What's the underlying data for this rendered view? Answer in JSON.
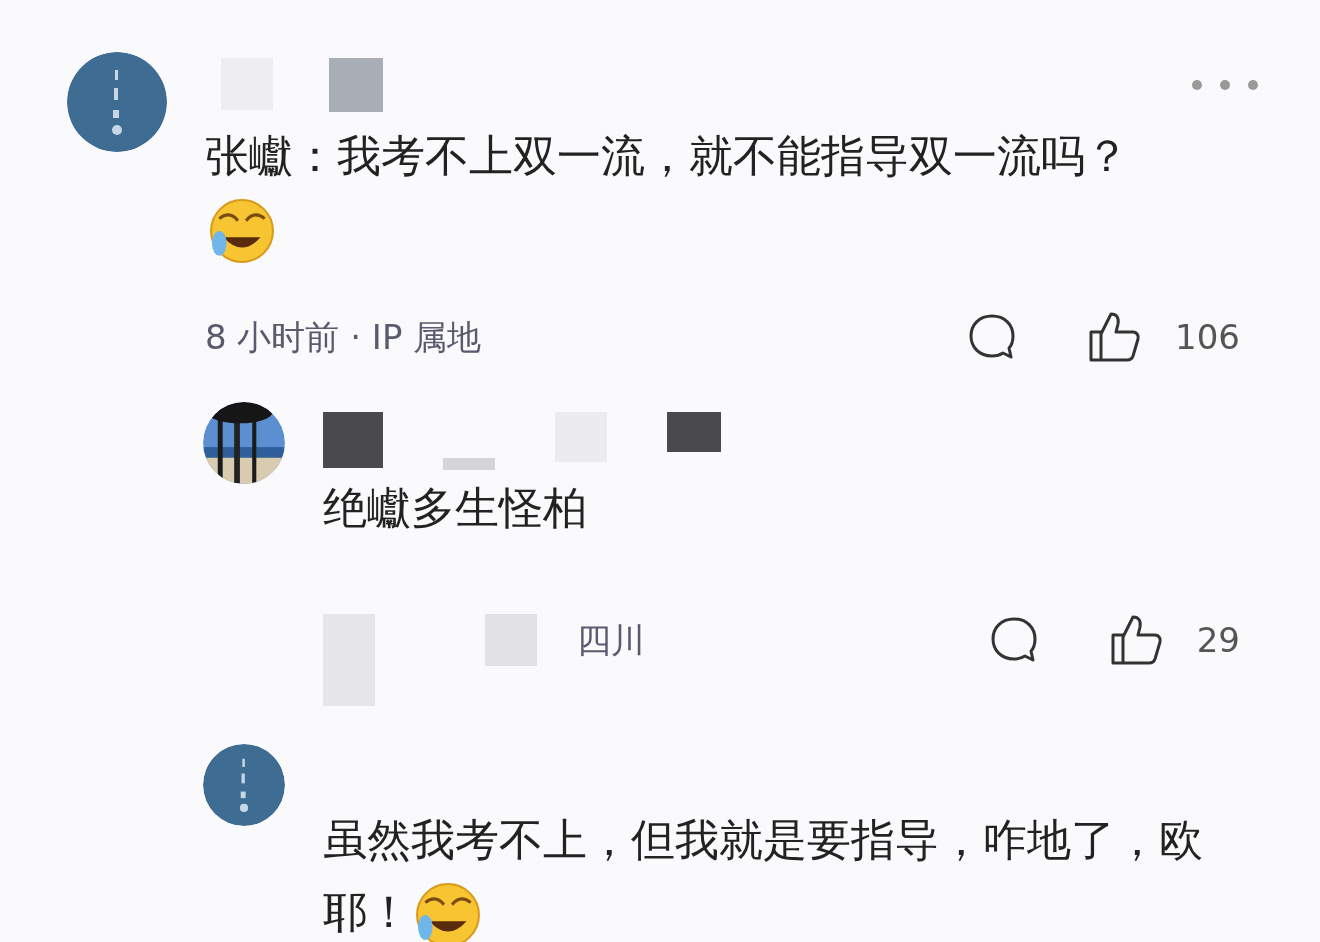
{
  "comments": [
    {
      "text": "张巘：我考不上双一流，就不能指导双一流吗？",
      "emoji": true,
      "meta": "8 小时前 · IP 属地",
      "likes": "106",
      "menu": true,
      "replies": [
        {
          "text": "绝巘多生怪柏",
          "emoji": false,
          "meta": "四川",
          "likes": "29"
        },
        {
          "text": "虽然我考不上，但我就是要指导，咋地了，欧耶！",
          "emoji": true
        }
      ]
    }
  ]
}
